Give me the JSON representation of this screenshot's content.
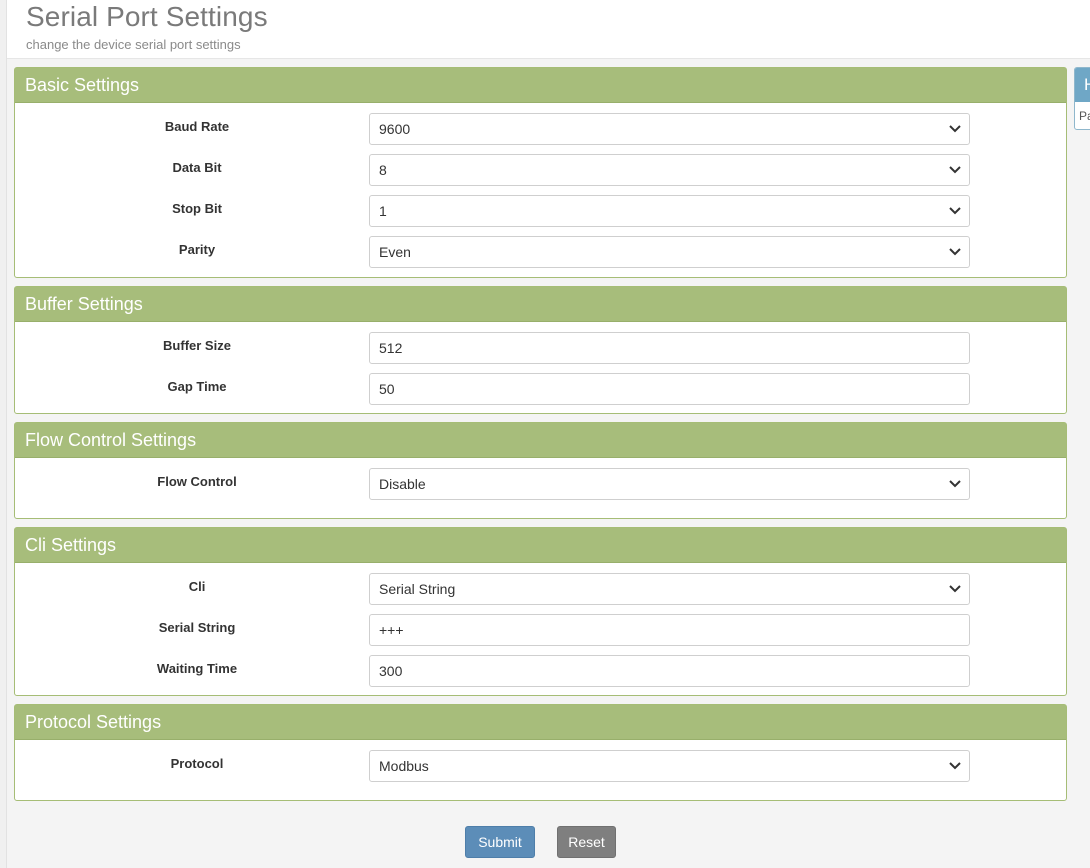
{
  "header": {
    "title": "Serial Port Settings",
    "subtitle": "change the device serial port settings"
  },
  "panels": {
    "basic": {
      "title": "Basic Settings",
      "baud_rate": {
        "label": "Baud Rate",
        "value": "9600"
      },
      "data_bit": {
        "label": "Data Bit",
        "value": "8"
      },
      "stop_bit": {
        "label": "Stop Bit",
        "value": "1"
      },
      "parity": {
        "label": "Parity",
        "value": "Even"
      }
    },
    "buffer": {
      "title": "Buffer Settings",
      "buffer_size": {
        "label": "Buffer Size",
        "value": "512"
      },
      "gap_time": {
        "label": "Gap Time",
        "value": "50"
      }
    },
    "flow": {
      "title": "Flow Control Settings",
      "flow_control": {
        "label": "Flow Control",
        "value": "Disable"
      }
    },
    "cli": {
      "title": "Cli Settings",
      "cli": {
        "label": "Cli",
        "value": "Serial String"
      },
      "serial_string": {
        "label": "Serial String",
        "value": "+++"
      },
      "waiting_time": {
        "label": "Waiting Time",
        "value": "300"
      }
    },
    "protocol": {
      "title": "Protocol Settings",
      "protocol": {
        "label": "Protocol",
        "value": "Modbus"
      }
    }
  },
  "side_panel": {
    "title": "H",
    "body": "Pa"
  },
  "buttons": {
    "submit": "Submit",
    "reset": "Reset"
  },
  "colors": {
    "panel_heading": "#a7bd7b",
    "submit_button": "#5c8db8",
    "reset_button": "#7f7f7f",
    "side_panel_heading": "#6fa7c6"
  },
  "icons": {
    "select_arrow": "chevron-down-icon"
  }
}
